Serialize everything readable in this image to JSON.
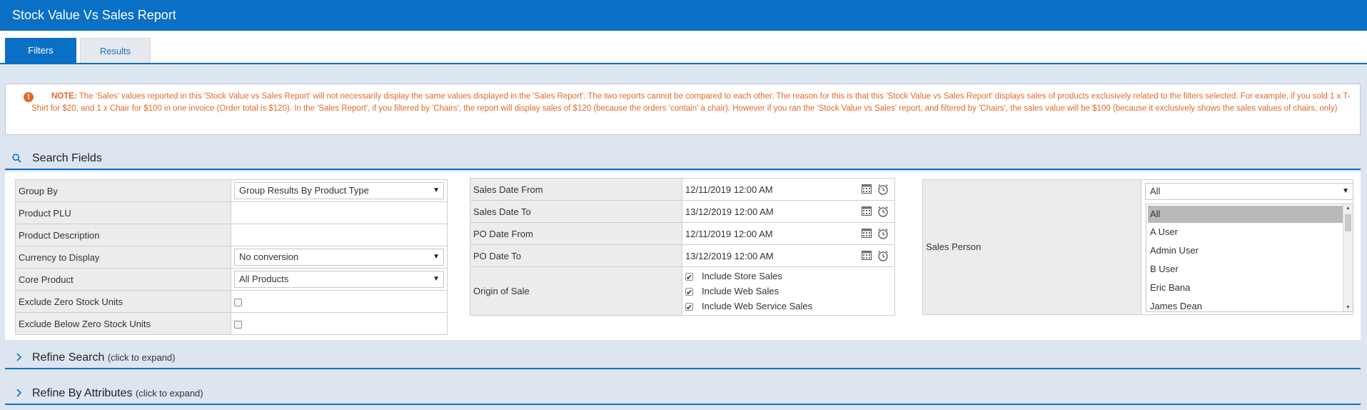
{
  "title": "Stock Value Vs Sales Report",
  "tabs": [
    {
      "label": "Filters",
      "active": true
    },
    {
      "label": "Results",
      "active": false
    }
  ],
  "note": {
    "icon": "exclamation-icon",
    "label": "NOTE:",
    "text": "The 'Sales' values reported in this 'Stock Value vs Sales Report' will not necessarily display the same values displayed in the 'Sales Report'. The two reports cannot be compared to each other. The reason for this is that this 'Stock Value vs Sales Report' displays sales of products exclusively related to the filters selected. For example, if you sold 1 x T-Shirt for $20, and 1 x Chair for $100 in one invoice (Order total is $120). In the 'Sales Report', if you filtered by 'Chairs', the report will display sales of $120 (because the orders 'contain' a chair). However if you ran the 'Stock Value vs Sales' report, and filtered by 'Chairs', the sales value will be $100 (because it exclusively shows the sales values of chairs, only)"
  },
  "search_fields": {
    "title": "Search Fields",
    "group_by": {
      "label": "Group By",
      "value": "Group Results By Product Type"
    },
    "product_plu": {
      "label": "Product PLU",
      "value": ""
    },
    "product_description": {
      "label": "Product Description",
      "value": ""
    },
    "currency": {
      "label": "Currency to Display",
      "value": "No conversion"
    },
    "core_product": {
      "label": "Core Product",
      "value": "All Products"
    },
    "exclude_zero": {
      "label": "Exclude Zero Stock Units",
      "checked": false
    },
    "exclude_below_zero": {
      "label": "Exclude Below Zero Stock Units",
      "checked": false
    },
    "sales_date_from": {
      "label": "Sales Date From",
      "value": "12/11/2019 12:00 AM"
    },
    "sales_date_to": {
      "label": "Sales Date To",
      "value": "13/12/2019 12:00 AM"
    },
    "po_date_from": {
      "label": "PO Date From",
      "value": "12/11/2019 12:00 AM"
    },
    "po_date_to": {
      "label": "PO Date To",
      "value": "13/12/2019 12:00 AM"
    },
    "origin": {
      "label": "Origin of Sale",
      "options": [
        {
          "label": "Include Store Sales",
          "checked": true
        },
        {
          "label": "Include Web Sales",
          "checked": true
        },
        {
          "label": "Include Web Service Sales",
          "checked": true
        }
      ]
    },
    "sales_person": {
      "label": "Sales Person",
      "selected": "All",
      "options": [
        "All",
        "A User",
        "Admin User",
        "B User",
        "Eric Bana",
        "James Dean"
      ]
    }
  },
  "refine_search": {
    "title": "Refine Search",
    "hint": "(click to expand)"
  },
  "refine_attributes": {
    "title": "Refine By Attributes",
    "hint": "(click to expand)"
  }
}
